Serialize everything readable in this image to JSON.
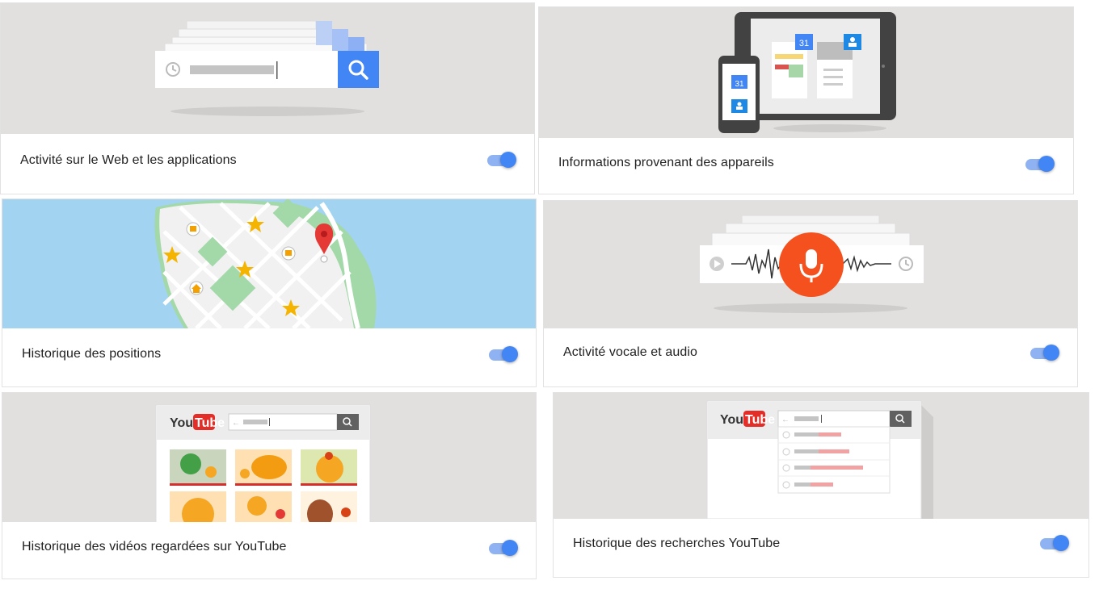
{
  "cards": [
    {
      "label": "Activité sur le Web et les applications",
      "enabled": true
    },
    {
      "label": "Informations provenant des appareils",
      "enabled": true
    },
    {
      "label": "Historique des positions",
      "enabled": true
    },
    {
      "label": "Activité vocale et audio",
      "enabled": true
    },
    {
      "label": "Historique des vidéos regardées sur YouTube",
      "enabled": true
    },
    {
      "label": "Historique des recherches YouTube",
      "enabled": true
    }
  ],
  "device_calendar_day": "31",
  "youtube_logo": "YouTube",
  "colors": {
    "toggle_on": "#4285f4",
    "toggle_track": "#8fb2f2",
    "illustration_bg": "#e2e0df",
    "map_water": "#a2d4f2",
    "youtube_red": "#e52d27",
    "mic_red": "#f4511e"
  }
}
